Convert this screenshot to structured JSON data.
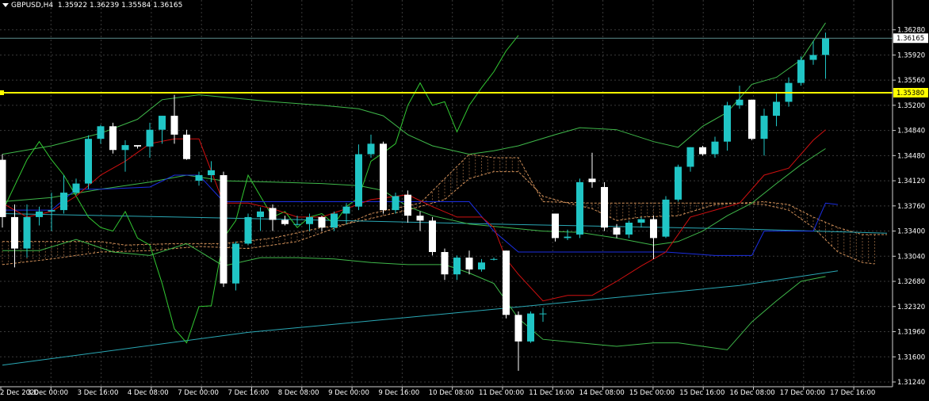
{
  "header": {
    "symbol": "GBPUSD,H4",
    "ohlc": "1.35922 1.36239 1.35584 1.36165"
  },
  "price_axis": {
    "ticks": [
      "1.36280",
      "1.35920",
      "1.35560",
      "1.35200",
      "1.34840",
      "1.34480",
      "1.34120",
      "1.33760",
      "1.33400",
      "1.33040",
      "1.32680",
      "1.32320",
      "1.31960",
      "1.31600",
      "1.31240"
    ],
    "current_price_label": "1.36165",
    "hline_label": "1.35380"
  },
  "time_axis": {
    "labels": [
      "2 Dec 2020",
      "3 Dec 00:00",
      "3 Dec 16:00",
      "4 Dec 08:00",
      "7 Dec 00:00",
      "7 Dec 16:00",
      "8 Dec 08:00",
      "9 Dec 00:00",
      "9 Dec 16:00",
      "10 Dec 08:00",
      "11 Dec 00:00",
      "11 Dec 16:00",
      "14 Dec 08:00",
      "15 Dec 00:00",
      "15 Dec 16:00",
      "16 Dec 08:00",
      "17 Dec 00:00",
      "17 Dec 16:00"
    ]
  },
  "colors": {
    "background": "#000000",
    "grid": "#3a3a3a",
    "bull": "#20c5c5",
    "bear": "#ffffff",
    "hline": "#ffff00",
    "bollinger": "#3fb84a",
    "ichimoku_tenkan": "#d01010",
    "ichimoku_kijun": "#1b2ee0",
    "chikou": "#32c832",
    "ma": "#2aa8b5",
    "cloud": "#d2915a"
  },
  "chart_data": {
    "type": "candlestick",
    "title": "GBPUSD,H4",
    "ylim": [
      1.3124,
      1.3648
    ],
    "grid": true,
    "hline": 1.3538,
    "candles": [
      [
        1.3442,
        1.345,
        1.3345,
        1.336
      ],
      [
        1.336,
        1.3378,
        1.3288,
        1.3315
      ],
      [
        1.3315,
        1.3378,
        1.3302,
        1.336
      ],
      [
        1.336,
        1.3375,
        1.3348,
        1.3368
      ],
      [
        1.3368,
        1.3395,
        1.334,
        1.337
      ],
      [
        1.337,
        1.342,
        1.3365,
        1.3395
      ],
      [
        1.3395,
        1.3415,
        1.3392,
        1.3408
      ],
      [
        1.3408,
        1.3477,
        1.34,
        1.3472
      ],
      [
        1.3472,
        1.3492,
        1.3465,
        1.349
      ],
      [
        1.349,
        1.3495,
        1.3451,
        1.3456
      ],
      [
        1.3456,
        1.347,
        1.3425,
        1.3463
      ],
      [
        1.3463,
        1.3462,
        1.3458,
        1.3461
      ],
      [
        1.3461,
        1.3495,
        1.3445,
        1.3485
      ],
      [
        1.3485,
        1.3505,
        1.3465,
        1.3505
      ],
      [
        1.3505,
        1.3535,
        1.3465,
        1.3478
      ],
      [
        1.3478,
        1.3485,
        1.3442,
        1.3443
      ],
      [
        1.3412,
        1.3425,
        1.3405,
        1.342
      ],
      [
        1.342,
        1.344,
        1.341,
        1.3427
      ],
      [
        1.342,
        1.3425,
        1.326,
        1.3265
      ],
      [
        1.3265,
        1.3325,
        1.3255,
        1.3322
      ],
      [
        1.3322,
        1.3365,
        1.332,
        1.336
      ],
      [
        1.336,
        1.3374,
        1.334,
        1.3368
      ],
      [
        1.3373,
        1.3378,
        1.334,
        1.3356
      ],
      [
        1.3356,
        1.3362,
        1.3348,
        1.335
      ],
      [
        1.335,
        1.3362,
        1.3348,
        1.335
      ],
      [
        1.335,
        1.3365,
        1.334,
        1.336
      ],
      [
        1.336,
        1.3362,
        1.334,
        1.3345
      ],
      [
        1.3345,
        1.3368,
        1.334,
        1.3365
      ],
      [
        1.3365,
        1.338,
        1.335,
        1.3375
      ],
      [
        1.3375,
        1.3464,
        1.337,
        1.345
      ],
      [
        1.345,
        1.3478,
        1.3445,
        1.3465
      ],
      [
        1.3465,
        1.3468,
        1.3365,
        1.337
      ],
      [
        1.337,
        1.3395,
        1.3365,
        1.339
      ],
      [
        1.3392,
        1.3398,
        1.3352,
        1.3362
      ],
      [
        1.3362,
        1.3368,
        1.334,
        1.3355
      ],
      [
        1.3355,
        1.336,
        1.3305,
        1.331
      ],
      [
        1.331,
        1.3315,
        1.327,
        1.3278
      ],
      [
        1.3278,
        1.3305,
        1.327,
        1.3302
      ],
      [
        1.3302,
        1.3312,
        1.3278,
        1.3285
      ],
      [
        1.3285,
        1.33,
        1.3282,
        1.3295
      ],
      [
        1.33,
        1.3302,
        1.3298,
        1.33
      ],
      [
        1.3312,
        1.3312,
        1.3215,
        1.322
      ],
      [
        1.322,
        1.3225,
        1.314,
        1.3182
      ],
      [
        1.3182,
        1.3225,
        1.318,
        1.3222
      ],
      [
        1.3222,
        1.323,
        1.321,
        1.3222
      ],
      [
        1.3365,
        1.3365,
        1.3325,
        1.333
      ],
      [
        1.333,
        1.3342,
        1.3327,
        1.3332
      ],
      [
        1.3335,
        1.3415,
        1.333,
        1.341
      ],
      [
        1.3415,
        1.3452,
        1.3402,
        1.341
      ],
      [
        1.3403,
        1.341,
        1.334,
        1.3345
      ],
      [
        1.3345,
        1.335,
        1.333,
        1.3335
      ],
      [
        1.3335,
        1.3355,
        1.333,
        1.3352
      ],
      [
        1.3352,
        1.336,
        1.3345,
        1.3357
      ],
      [
        1.3357,
        1.3362,
        1.33,
        1.333
      ],
      [
        1.3332,
        1.339,
        1.333,
        1.3385
      ],
      [
        1.3385,
        1.3435,
        1.3382,
        1.3432
      ],
      [
        1.3432,
        1.346,
        1.3425,
        1.346
      ],
      [
        1.346,
        1.3462,
        1.3448,
        1.345
      ],
      [
        1.345,
        1.3475,
        1.3445,
        1.3468
      ],
      [
        1.3468,
        1.3525,
        1.3455,
        1.352
      ],
      [
        1.352,
        1.3548,
        1.3515,
        1.3528
      ],
      [
        1.3528,
        1.3528,
        1.347,
        1.3472
      ],
      [
        1.3472,
        1.3515,
        1.3448,
        1.3505
      ],
      [
        1.3505,
        1.3538,
        1.349,
        1.3525
      ],
      [
        1.3525,
        1.356,
        1.3518,
        1.3552
      ],
      [
        1.3552,
        1.359,
        1.3548,
        1.3585
      ],
      [
        1.3585,
        1.3612,
        1.3578,
        1.3592
      ],
      [
        1.3592,
        1.3624,
        1.3558,
        1.3616
      ]
    ],
    "indicators": {
      "bb_upper": [
        [
          0,
          1.345
        ],
        [
          4,
          1.3462
        ],
        [
          8,
          1.348
        ],
        [
          11,
          1.35
        ],
        [
          13,
          1.3528
        ],
        [
          16,
          1.3535
        ],
        [
          19,
          1.353
        ],
        [
          22,
          1.3525
        ],
        [
          26,
          1.352
        ],
        [
          29,
          1.3515
        ],
        [
          31,
          1.3505
        ],
        [
          33,
          1.3478
        ],
        [
          35,
          1.3462
        ],
        [
          38,
          1.345
        ],
        [
          40,
          1.3455
        ],
        [
          42,
          1.3462
        ],
        [
          45,
          1.3478
        ],
        [
          47,
          1.3488
        ],
        [
          50,
          1.3485
        ],
        [
          53,
          1.3468
        ],
        [
          55,
          1.346
        ],
        [
          57,
          1.349
        ],
        [
          59,
          1.351
        ],
        [
          61,
          1.355
        ],
        [
          63,
          1.356
        ],
        [
          65,
          1.3585
        ],
        [
          67,
          1.3638
        ]
      ],
      "bb_mid": [
        [
          0,
          1.3382
        ],
        [
          4,
          1.3388
        ],
        [
          8,
          1.34
        ],
        [
          12,
          1.341
        ],
        [
          15,
          1.342
        ],
        [
          18,
          1.3412
        ],
        [
          22,
          1.341
        ],
        [
          26,
          1.3408
        ],
        [
          29,
          1.3405
        ],
        [
          31,
          1.3398
        ],
        [
          33,
          1.3375
        ],
        [
          35,
          1.3362
        ],
        [
          38,
          1.335
        ],
        [
          41,
          1.3345
        ],
        [
          44,
          1.334
        ],
        [
          47,
          1.3338
        ],
        [
          50,
          1.333
        ],
        [
          53,
          1.332
        ],
        [
          55,
          1.3325
        ],
        [
          57,
          1.334
        ],
        [
          59,
          1.3362
        ],
        [
          61,
          1.338
        ],
        [
          63,
          1.3408
        ],
        [
          65,
          1.3435
        ],
        [
          67,
          1.3458
        ]
      ],
      "bb_lower": [
        [
          0,
          1.3312
        ],
        [
          3,
          1.3312
        ],
        [
          6,
          1.3328
        ],
        [
          9,
          1.331
        ],
        [
          12,
          1.3305
        ],
        [
          15,
          1.3322
        ],
        [
          18,
          1.329
        ],
        [
          21,
          1.3302
        ],
        [
          24,
          1.3302
        ],
        [
          27,
          1.33
        ],
        [
          30,
          1.3295
        ],
        [
          33,
          1.3292
        ],
        [
          36,
          1.3292
        ],
        [
          38,
          1.328
        ],
        [
          40,
          1.3265
        ],
        [
          42,
          1.3215
        ],
        [
          44,
          1.3185
        ],
        [
          47,
          1.318
        ],
        [
          50,
          1.3175
        ],
        [
          53,
          1.318
        ],
        [
          55,
          1.318
        ],
        [
          57,
          1.3175
        ],
        [
          59,
          1.317
        ],
        [
          61,
          1.321
        ],
        [
          63,
          1.324
        ],
        [
          65,
          1.3268
        ],
        [
          67,
          1.3275
        ]
      ],
      "tenkan": [
        [
          0,
          1.338
        ],
        [
          2,
          1.336
        ],
        [
          4,
          1.3368
        ],
        [
          6,
          1.339
        ],
        [
          8,
          1.342
        ],
        [
          10,
          1.344
        ],
        [
          12,
          1.3465
        ],
        [
          14,
          1.3472
        ],
        [
          16,
          1.3472
        ],
        [
          18,
          1.338
        ],
        [
          20,
          1.338
        ],
        [
          22,
          1.3372
        ],
        [
          24,
          1.336
        ],
        [
          26,
          1.336
        ],
        [
          28,
          1.3372
        ],
        [
          30,
          1.3385
        ],
        [
          33,
          1.3392
        ],
        [
          35,
          1.3375
        ],
        [
          37,
          1.336
        ],
        [
          39,
          1.336
        ],
        [
          40,
          1.3345
        ],
        [
          41,
          1.33
        ],
        [
          42,
          1.3278
        ],
        [
          44,
          1.324
        ],
        [
          46,
          1.3248
        ],
        [
          48,
          1.3248
        ],
        [
          50,
          1.3268
        ],
        [
          52,
          1.329
        ],
        [
          54,
          1.331
        ],
        [
          56,
          1.336
        ],
        [
          58,
          1.337
        ],
        [
          60,
          1.338
        ],
        [
          62,
          1.342
        ],
        [
          64,
          1.343
        ],
        [
          66,
          1.347
        ],
        [
          67,
          1.3485
        ]
      ],
      "kijun": [
        [
          0,
          1.337
        ],
        [
          2,
          1.337
        ],
        [
          4,
          1.337
        ],
        [
          6,
          1.34
        ],
        [
          8,
          1.34
        ],
        [
          12,
          1.3403
        ],
        [
          14,
          1.342
        ],
        [
          16,
          1.342
        ],
        [
          18,
          1.3382
        ],
        [
          22,
          1.3382
        ],
        [
          26,
          1.3382
        ],
        [
          30,
          1.3382
        ],
        [
          33,
          1.3382
        ],
        [
          38,
          1.3382
        ],
        [
          40,
          1.334
        ],
        [
          42,
          1.331
        ],
        [
          46,
          1.331
        ],
        [
          50,
          1.331
        ],
        [
          54,
          1.331
        ],
        [
          58,
          1.3305
        ],
        [
          61,
          1.3305
        ],
        [
          62,
          1.334
        ],
        [
          66,
          1.334
        ],
        [
          67,
          1.338
        ],
        [
          68,
          1.3378
        ]
      ],
      "ma": [
        [
          0,
          1.3148
        ],
        [
          20,
          1.3195
        ],
        [
          40,
          1.3228
        ],
        [
          60,
          1.3262
        ],
        [
          68,
          1.3283
        ]
      ],
      "ma_flat": [
        [
          0,
          1.3365
        ],
        [
          20,
          1.3358
        ],
        [
          40,
          1.335
        ],
        [
          60,
          1.3343
        ],
        [
          72,
          1.3337
        ]
      ],
      "chikou": [
        [
          0,
          1.3368
        ],
        [
          2,
          1.3442
        ],
        [
          3,
          1.3468
        ],
        [
          4,
          1.3442
        ],
        [
          5,
          1.342
        ],
        [
          7,
          1.336
        ],
        [
          8,
          1.3345
        ],
        [
          9,
          1.334
        ],
        [
          10,
          1.3368
        ],
        [
          11,
          1.333
        ],
        [
          12,
          1.332
        ],
        [
          13,
          1.3265
        ],
        [
          14,
          1.32
        ],
        [
          15,
          1.318
        ],
        [
          16,
          1.3232
        ],
        [
          17,
          1.3233
        ],
        [
          18,
          1.333
        ],
        [
          19,
          1.3355
        ],
        [
          20,
          1.342
        ],
        [
          21,
          1.339
        ],
        [
          22,
          1.336
        ],
        [
          23,
          1.3368
        ],
        [
          24,
          1.3345
        ],
        [
          25,
          1.336
        ],
        [
          26,
          1.3365
        ],
        [
          27,
          1.335
        ],
        [
          28,
          1.3375
        ],
        [
          29,
          1.3388
        ],
        [
          30,
          1.344
        ],
        [
          31,
          1.3452
        ],
        [
          32,
          1.3465
        ],
        [
          33,
          1.352
        ],
        [
          34,
          1.3552
        ],
        [
          35,
          1.352
        ],
        [
          36,
          1.3525
        ],
        [
          37,
          1.3482
        ],
        [
          38,
          1.352
        ],
        [
          39,
          1.3545
        ],
        [
          40,
          1.3568
        ],
        [
          41,
          1.3598
        ],
        [
          42,
          1.362
        ]
      ],
      "cloud_a": [
        [
          0,
          1.3325
        ],
        [
          4,
          1.3325
        ],
        [
          8,
          1.3325
        ],
        [
          10,
          1.332
        ],
        [
          14,
          1.3322
        ],
        [
          18,
          1.3322
        ],
        [
          22,
          1.333
        ],
        [
          26,
          1.3345
        ],
        [
          28,
          1.335
        ],
        [
          30,
          1.3358
        ],
        [
          33,
          1.337
        ],
        [
          36,
          1.3385
        ],
        [
          38,
          1.3415
        ],
        [
          40,
          1.3425
        ],
        [
          42,
          1.3425
        ],
        [
          44,
          1.339
        ],
        [
          46,
          1.338
        ],
        [
          48,
          1.3372
        ],
        [
          50,
          1.3355
        ],
        [
          52,
          1.336
        ],
        [
          55,
          1.3362
        ],
        [
          58,
          1.3378
        ],
        [
          60,
          1.338
        ],
        [
          62,
          1.3382
        ],
        [
          64,
          1.3378
        ],
        [
          66,
          1.336
        ],
        [
          68,
          1.3345
        ],
        [
          70,
          1.3335
        ],
        [
          72,
          1.3335
        ]
      ],
      "cloud_b": [
        [
          0,
          1.3292
        ],
        [
          4,
          1.33
        ],
        [
          8,
          1.331
        ],
        [
          12,
          1.3312
        ],
        [
          16,
          1.3318
        ],
        [
          20,
          1.3315
        ],
        [
          24,
          1.3325
        ],
        [
          28,
          1.335
        ],
        [
          30,
          1.3365
        ],
        [
          34,
          1.338
        ],
        [
          38,
          1.345
        ],
        [
          40,
          1.3445
        ],
        [
          42,
          1.3445
        ],
        [
          44,
          1.3382
        ],
        [
          48,
          1.338
        ],
        [
          52,
          1.338
        ],
        [
          56,
          1.338
        ],
        [
          60,
          1.338
        ],
        [
          62,
          1.3378
        ],
        [
          64,
          1.337
        ],
        [
          66,
          1.3345
        ],
        [
          68,
          1.331
        ],
        [
          70,
          1.3295
        ],
        [
          71,
          1.3293
        ]
      ]
    }
  }
}
